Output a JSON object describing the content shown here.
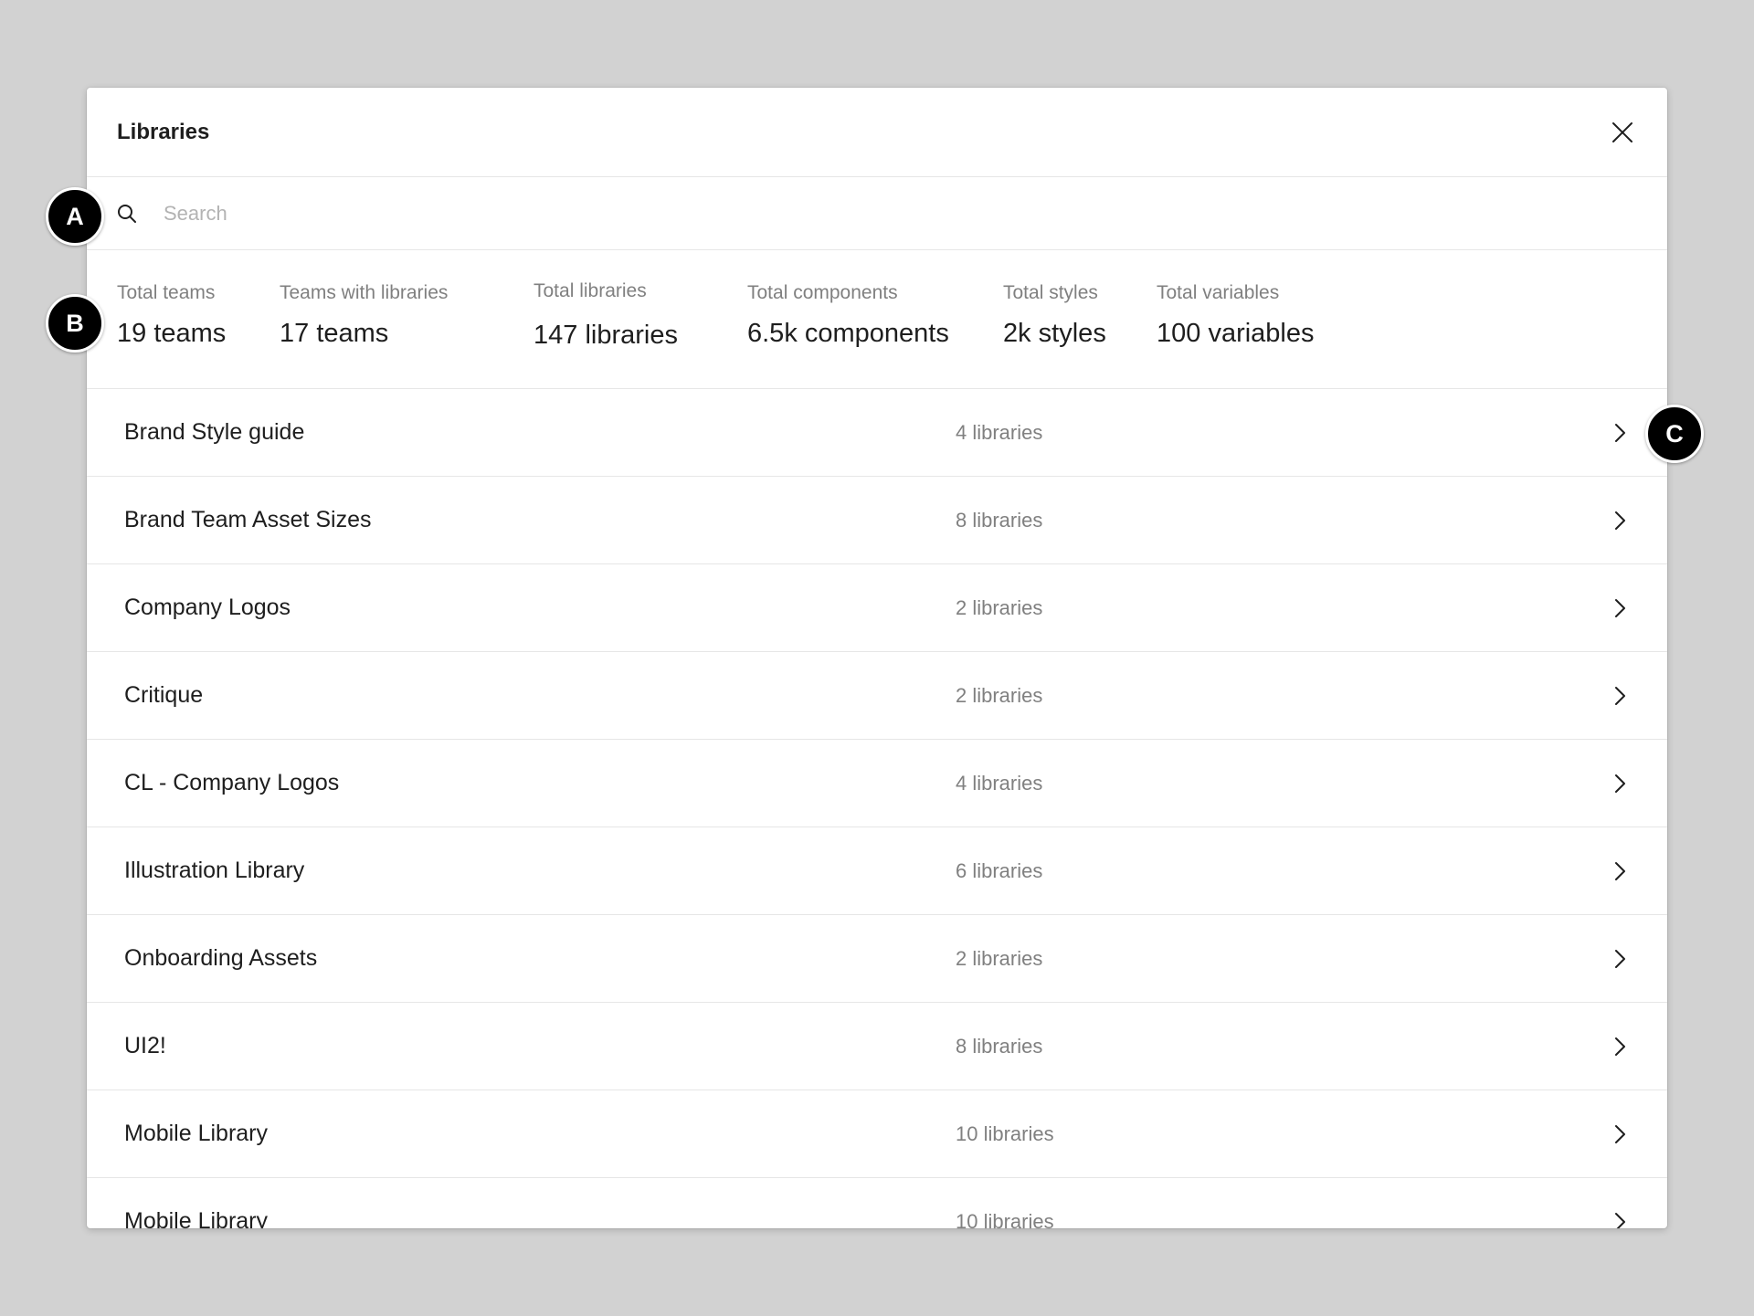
{
  "dialog": {
    "title": "Libraries"
  },
  "search": {
    "placeholder": "Search",
    "value": ""
  },
  "stats": [
    {
      "label": "Total teams",
      "value": "19 teams"
    },
    {
      "label": "Teams with libraries",
      "value": "17 teams"
    },
    {
      "label": "Total libraries",
      "value": "147 libraries"
    },
    {
      "label": "Total components",
      "value": "6.5k components"
    },
    {
      "label": "Total styles",
      "value": "2k styles"
    },
    {
      "label": "Total variables",
      "value": "100 variables"
    }
  ],
  "teams": [
    {
      "name": "Brand Style guide",
      "count": "4 libraries"
    },
    {
      "name": "Brand Team Asset Sizes",
      "count": "8 libraries"
    },
    {
      "name": "Company Logos",
      "count": "2 libraries"
    },
    {
      "name": "Critique",
      "count": "2 libraries"
    },
    {
      "name": "CL - Company Logos",
      "count": "4 libraries"
    },
    {
      "name": "Illustration Library",
      "count": "6 libraries"
    },
    {
      "name": "Onboarding Assets",
      "count": "2 libraries"
    },
    {
      "name": "UI2!",
      "count": "8 libraries"
    },
    {
      "name": "Mobile Library",
      "count": "10 libraries"
    },
    {
      "name": "Mobile Library",
      "count": "10 libraries"
    }
  ],
  "callouts": {
    "a": "A",
    "b": "B",
    "c": "C"
  },
  "icons": {
    "close": "close-icon",
    "search": "search-icon",
    "chevron": "chevron-right-icon"
  }
}
